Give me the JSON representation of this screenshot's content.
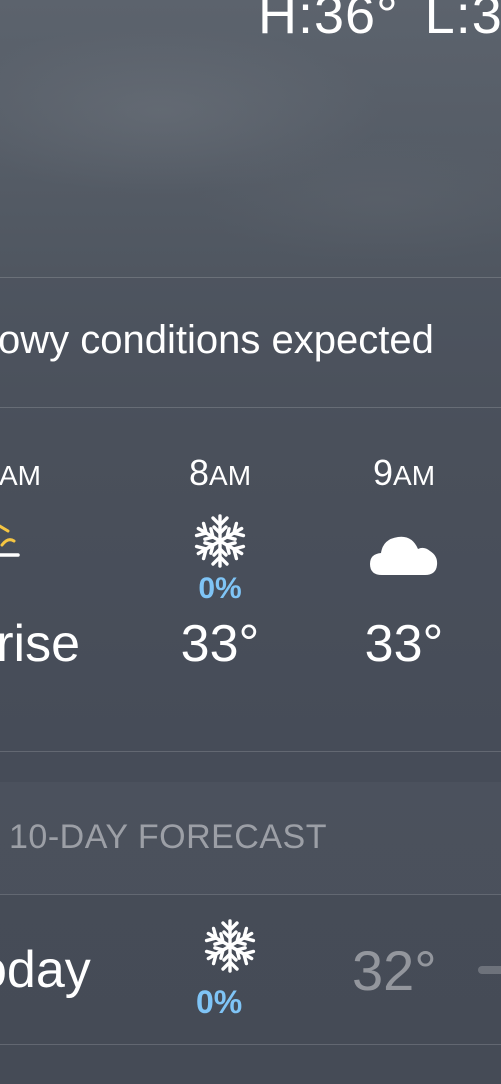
{
  "header": {
    "high": "H:36°",
    "low": "L:3"
  },
  "summary": {
    "text": "owy conditions expected"
  },
  "hourly": [
    {
      "time": "AM",
      "icon": "sunrise-icon",
      "value": "rise"
    },
    {
      "time_num": "8",
      "time_suffix": "AM",
      "icon": "snowflake-icon",
      "precip": "0%",
      "temp": "33°"
    },
    {
      "time_num": "9",
      "time_suffix": "AM",
      "icon": "cloud-icon",
      "temp": "33°"
    }
  ],
  "forecast": {
    "header": "10-DAY FORECAST",
    "days": [
      {
        "name": "oday",
        "icon": "snowflake-icon",
        "precip": "0%",
        "low": "32°"
      }
    ]
  },
  "colors": {
    "precip": "#7fc4f6",
    "sun": "#f5c542",
    "background": "#4a505b"
  }
}
